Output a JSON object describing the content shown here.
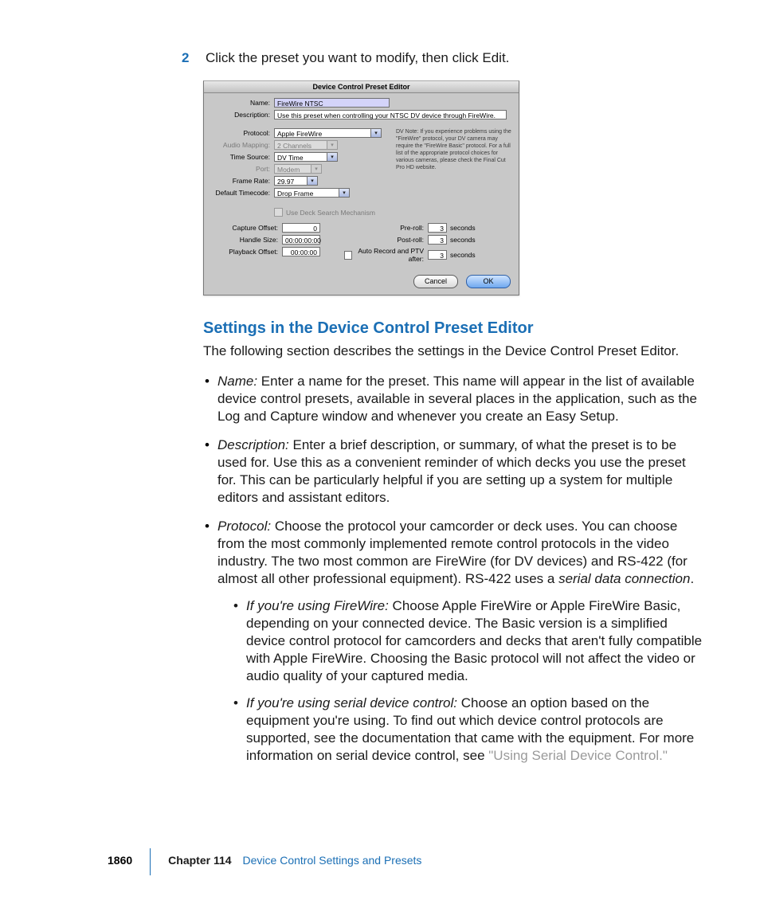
{
  "step": {
    "num": "2",
    "text": "Click the preset you want to modify, then click Edit."
  },
  "dialog": {
    "title": "Device Control Preset Editor",
    "name_label": "Name:",
    "name_value": "FireWire NTSC",
    "desc_label": "Description:",
    "desc_value": "Use this preset when controlling your NTSC DV device through FireWire.",
    "protocol_label": "Protocol:",
    "protocol_value": "Apple FireWire",
    "audio_label": "Audio Mapping:",
    "audio_value": "2 Channels",
    "timesrc_label": "Time Source:",
    "timesrc_value": "DV Time",
    "port_label": "Port:",
    "port_value": "Modem",
    "rate_label": "Frame Rate:",
    "rate_value": "29.97",
    "tc_label": "Default Timecode:",
    "tc_value": "Drop Frame",
    "note": "DV Note: If you experience problems using the \"FireWire\" protocol, your DV camera may require the \"FireWire Basic\" protocol. For a full list of the appropriate protocol choices for various cameras, please check the Final Cut Pro HD website.",
    "deck_check": "Use Deck Search Mechanism",
    "cap_label": "Capture Offset:",
    "cap_value": "0",
    "handle_label": "Handle Size:",
    "handle_value": "00:00:00:00",
    "play_label": "Playback Offset:",
    "play_value": "00:00:00",
    "preroll_label": "Pre-roll:",
    "preroll_value": "3",
    "postroll_label": "Post-roll:",
    "postroll_value": "3",
    "auto_label": "Auto Record and PTV after:",
    "auto_value": "3",
    "seconds": "seconds",
    "cancel": "Cancel",
    "ok": "OK"
  },
  "heading": "Settings in the Device Control Preset Editor",
  "intro": "The following section describes the settings in the Device Control Preset Editor.",
  "bullets": {
    "name_term": "Name:  ",
    "name_text": "Enter a name for the preset. This name will appear in the list of available device control presets, available in several places in the application, such as the Log and Capture window and whenever you create an Easy Setup.",
    "desc_term": "Description:  ",
    "desc_text": "Enter a brief description, or summary, of what the preset is to be used for. Use this as a convenient reminder of which decks you use the preset for. This can be particularly helpful if you are setting up a system for multiple editors and assistant editors.",
    "proto_term": "Protocol:  ",
    "proto_text1": "Choose the protocol your camcorder or deck uses. You can choose from the most commonly implemented remote control protocols in the video industry. The two most common are FireWire (for DV devices) and RS-422 (for almost all other professional equipment). RS-422 uses a ",
    "proto_em": "serial data connection",
    "proto_text2": ".",
    "fw_term": "If you're using FireWire:  ",
    "fw_text": "Choose Apple FireWire or Apple FireWire Basic, depending on your connected device. The Basic version is a simplified device control protocol for camcorders and decks that aren't fully compatible with Apple FireWire. Choosing the Basic protocol will not affect the video or audio quality of your captured media.",
    "ser_term": "If you're using serial device control:  ",
    "ser_text": "Choose an option based on the equipment you're using. To find out which device control protocols are supported, see the documentation that came with the equipment. For more information on serial device control, see ",
    "ser_link": "\"Using Serial Device Control.\""
  },
  "footer": {
    "page": "1860",
    "chapter_label": "Chapter 114",
    "chapter_name": "Device Control Settings and Presets"
  }
}
